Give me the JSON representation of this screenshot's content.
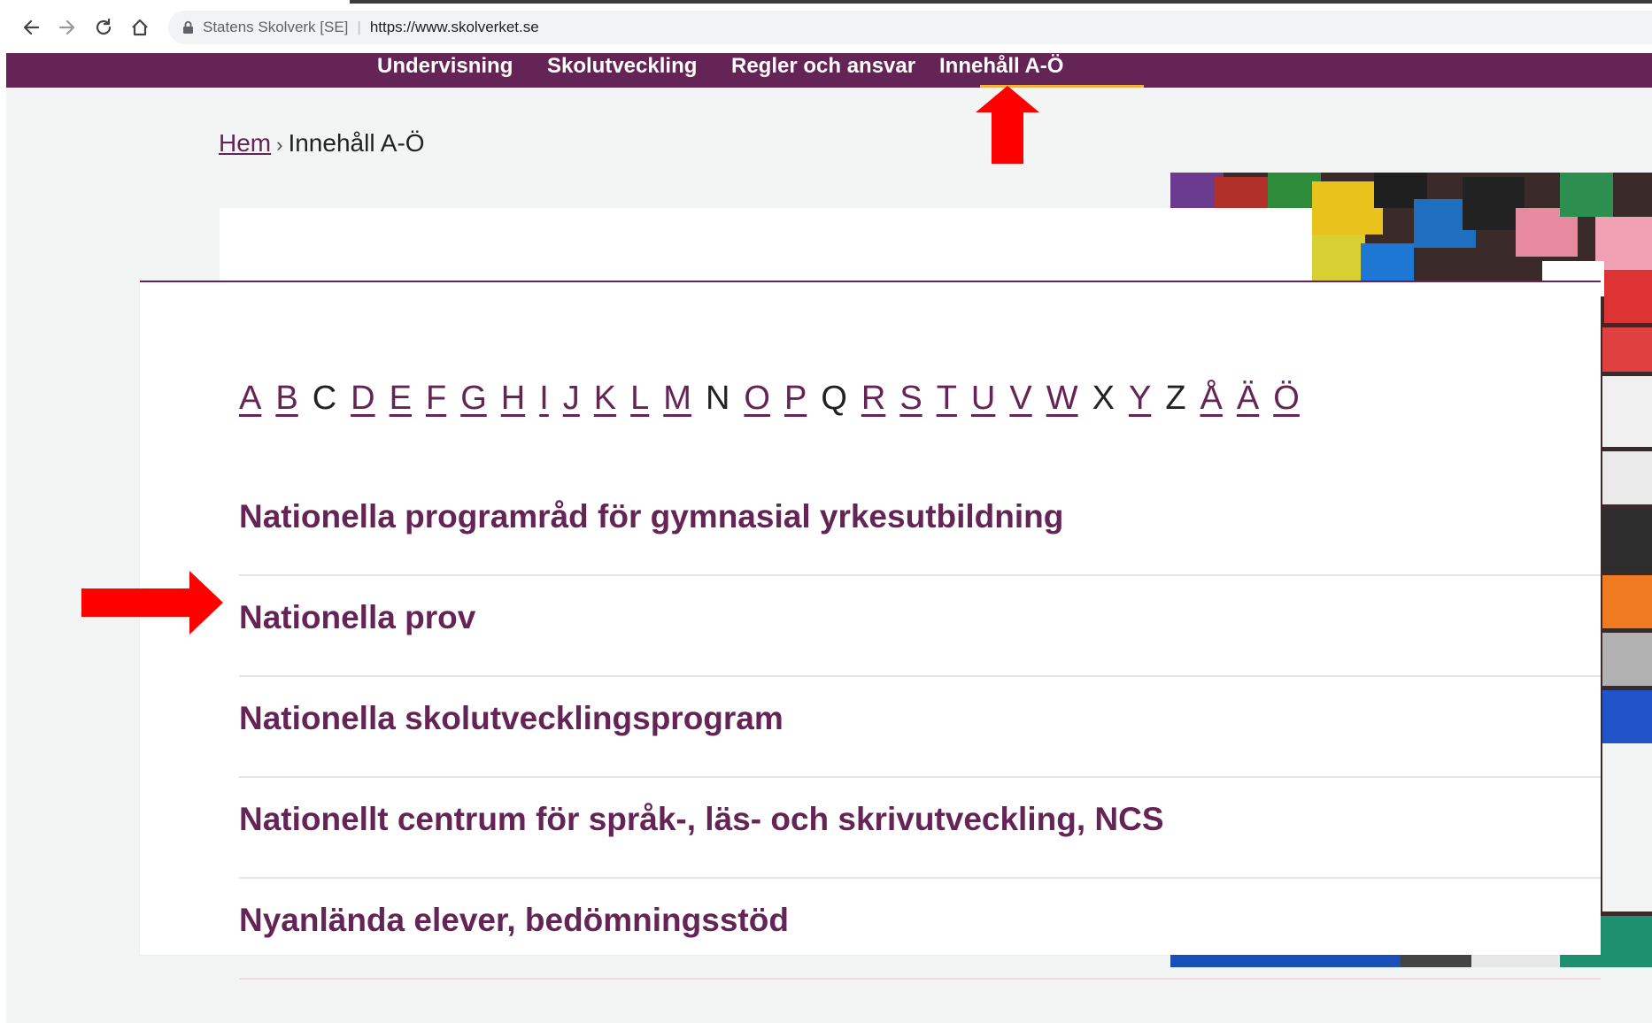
{
  "browser": {
    "site_name": "Statens Skolverk [SE]",
    "separator": "|",
    "url": "https://www.skolverket.se"
  },
  "site_nav": {
    "items": [
      {
        "label": "Undervisning"
      },
      {
        "label": "Skolutveckling"
      },
      {
        "label": "Regler och ansvar"
      },
      {
        "label": "Innehåll A-Ö",
        "active": true
      }
    ]
  },
  "breadcrumb": {
    "home": "Hem",
    "separator": "›",
    "current": "Innehåll A-Ö"
  },
  "alphabet": [
    {
      "letter": "A",
      "link": true
    },
    {
      "letter": "B",
      "link": true
    },
    {
      "letter": "C",
      "link": false
    },
    {
      "letter": "D",
      "link": true
    },
    {
      "letter": "E",
      "link": true
    },
    {
      "letter": "F",
      "link": true
    },
    {
      "letter": "G",
      "link": true
    },
    {
      "letter": "H",
      "link": true
    },
    {
      "letter": "I",
      "link": true
    },
    {
      "letter": "J",
      "link": true
    },
    {
      "letter": "K",
      "link": true
    },
    {
      "letter": "L",
      "link": true
    },
    {
      "letter": "M",
      "link": true
    },
    {
      "letter": "N",
      "link": false
    },
    {
      "letter": "O",
      "link": true
    },
    {
      "letter": "P",
      "link": true
    },
    {
      "letter": "Q",
      "link": false
    },
    {
      "letter": "R",
      "link": true
    },
    {
      "letter": "S",
      "link": true
    },
    {
      "letter": "T",
      "link": true
    },
    {
      "letter": "U",
      "link": true
    },
    {
      "letter": "V",
      "link": true
    },
    {
      "letter": "W",
      "link": true
    },
    {
      "letter": "X",
      "link": false
    },
    {
      "letter": "Y",
      "link": true
    },
    {
      "letter": "Z",
      "link": false
    },
    {
      "letter": "Å",
      "link": true
    },
    {
      "letter": "Ä",
      "link": true
    },
    {
      "letter": "Ö",
      "link": true
    }
  ],
  "entries": [
    {
      "label": "Nationella programråd för gymnasial yrkesutbildning"
    },
    {
      "label": "Nationella prov"
    },
    {
      "label": "Nationella skolutvecklingsprogram"
    },
    {
      "label": "Nationellt centrum för språk-, läs- och skrivutveckling, NCS"
    },
    {
      "label": "Nyanlända elever, bedömningsstöd"
    }
  ],
  "colors": {
    "brand": "#652456",
    "active_underline": "#f2b13d",
    "page_background": "#f2f5f4",
    "annotation_arrow": "#ff0000"
  },
  "icons": {
    "back": "arrow-left-icon",
    "forward": "arrow-right-icon",
    "reload": "reload-icon",
    "home": "home-icon",
    "secure": "lock-icon"
  }
}
